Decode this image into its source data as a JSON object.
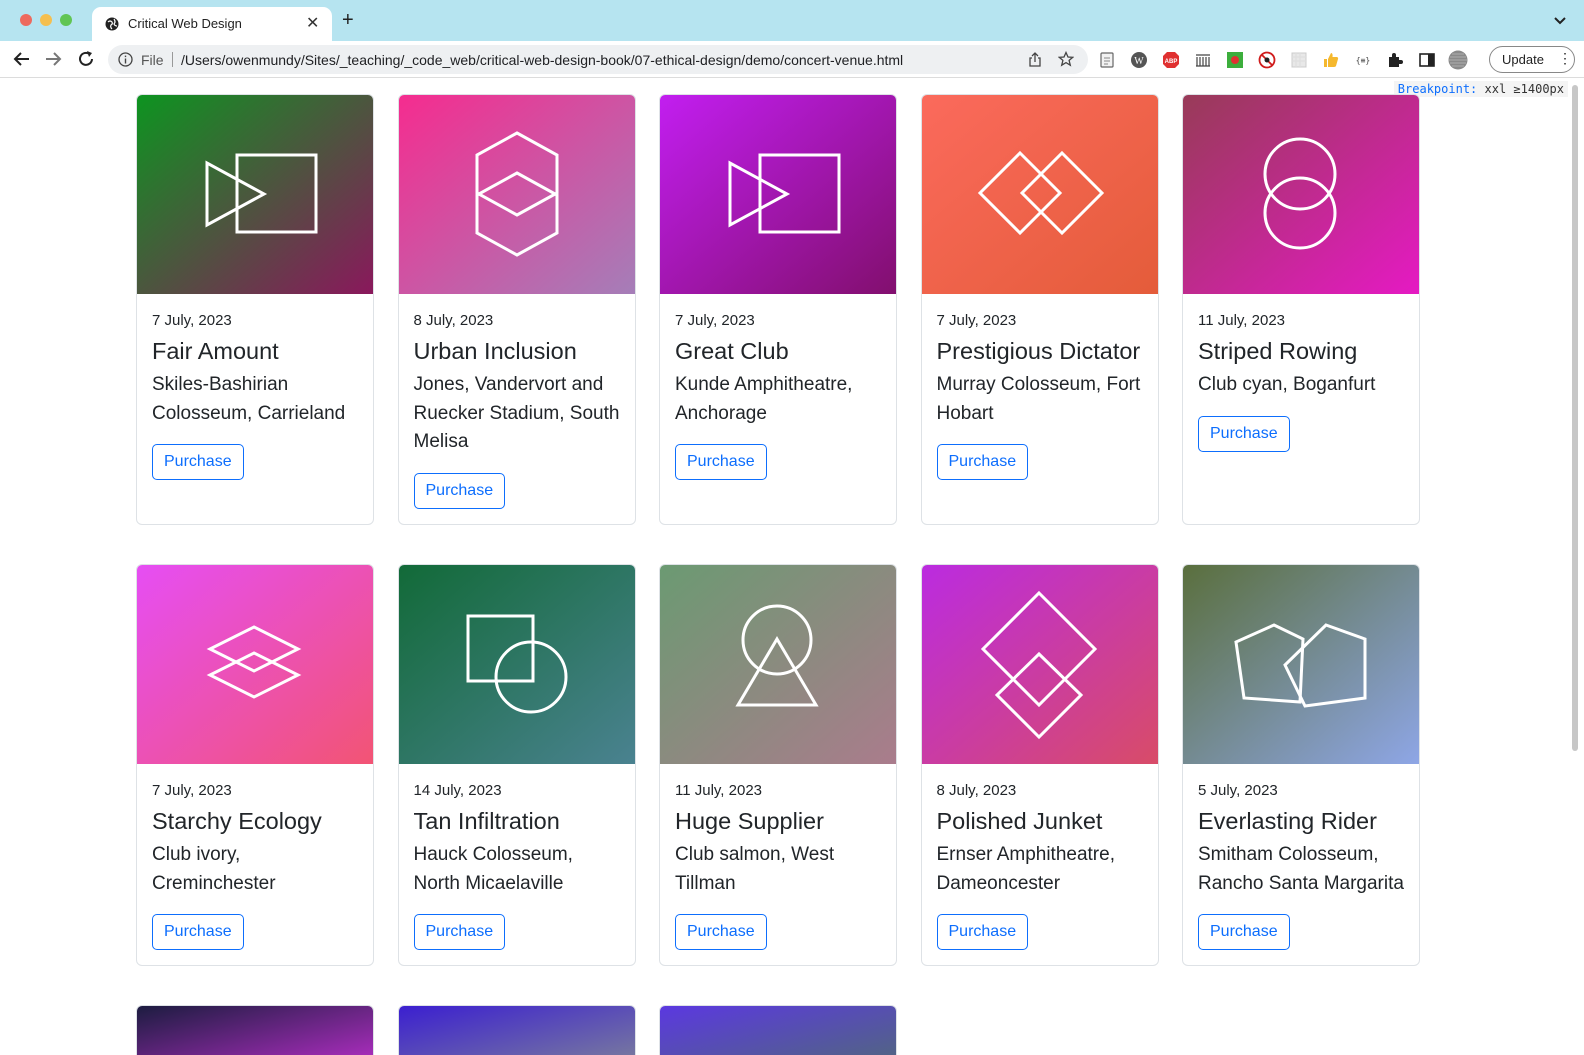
{
  "browser": {
    "tab_title": "Critical Web Design",
    "omnibox_scheme": "File",
    "url": "/Users/owenmundy/Sites/_teaching/_code_web/critical-web-design-book/07-ethical-design/demo/concert-venue.html",
    "update_label": "Update"
  },
  "page": {
    "breakpoint_label": "Breakpoint:",
    "breakpoint_value": "xxl ≥1400px",
    "button_label": "Purchase",
    "cards": [
      {
        "date": "7 July, 2023",
        "title": "Fair Amount",
        "venue": "Skiles-Bashirian Colosseum, Carrieland",
        "icon": "play-rectangle-icon",
        "gradient": [
          "#0d9420",
          "#8a185c"
        ]
      },
      {
        "date": "8 July, 2023",
        "title": "Urban Inclusion",
        "venue": "Jones, Vandervort and Ruecker Stadium, South Melisa",
        "icon": "stacked-hexagons-icon",
        "gradient": [
          "#f52c8f",
          "#a57eb8"
        ]
      },
      {
        "date": "7 July, 2023",
        "title": "Great Club",
        "venue": "Kunde Amphitheatre, Anchorage",
        "icon": "play-rectangle-icon",
        "gradient": [
          "#c21ef0",
          "#820f6e"
        ]
      },
      {
        "date": "7 July, 2023",
        "title": "Prestigious Dictator",
        "venue": "Murray Colosseum, Fort Hobart",
        "icon": "double-diamond-icon",
        "gradient": [
          "#fb6a5c",
          "#e45c3a"
        ]
      },
      {
        "date": "11 July, 2023",
        "title": "Striped Rowing",
        "venue": "Club cyan, Boganfurt",
        "icon": "stacked-circles-icon",
        "gradient": [
          "#983b58",
          "#e51ac3"
        ]
      },
      {
        "date": "7 July, 2023",
        "title": "Starchy Ecology",
        "venue": "Club ivory, Creminchester",
        "icon": "layered-diamonds-icon",
        "gradient": [
          "#e64ef4",
          "#f25474"
        ]
      },
      {
        "date": "14 July, 2023",
        "title": "Tan Infiltration",
        "venue": "Hauck Colosseum, North Micaelaville",
        "icon": "square-circle-icon",
        "gradient": [
          "#126a38",
          "#4a8290"
        ]
      },
      {
        "date": "11 July, 2023",
        "title": "Huge Supplier",
        "venue": "Club salmon, West Tillman",
        "icon": "circle-triangle-icon",
        "gradient": [
          "#6b9a72",
          "#aa7c8c"
        ]
      },
      {
        "date": "8 July, 2023",
        "title": "Polished Junket",
        "venue": "Ernser Amphitheatre, Dameoncester",
        "icon": "stacked-diamonds-icon",
        "gradient": [
          "#bb2be0",
          "#d84c68"
        ]
      },
      {
        "date": "5 July, 2023",
        "title": "Everlasting Rider",
        "venue": "Smitham Colosseum, Rancho Santa Margarita",
        "icon": "twin-pentagons-icon",
        "gradient": [
          "#5a6f3d",
          "#8ea6e6"
        ]
      }
    ],
    "partial_cards": [
      {
        "gradient": [
          "#1c1c40",
          "#b22ec4"
        ]
      },
      {
        "gradient": [
          "#3b1fd0",
          "#7b7e9c"
        ]
      },
      {
        "gradient": [
          "#5b38e0",
          "#51677e"
        ]
      }
    ]
  }
}
